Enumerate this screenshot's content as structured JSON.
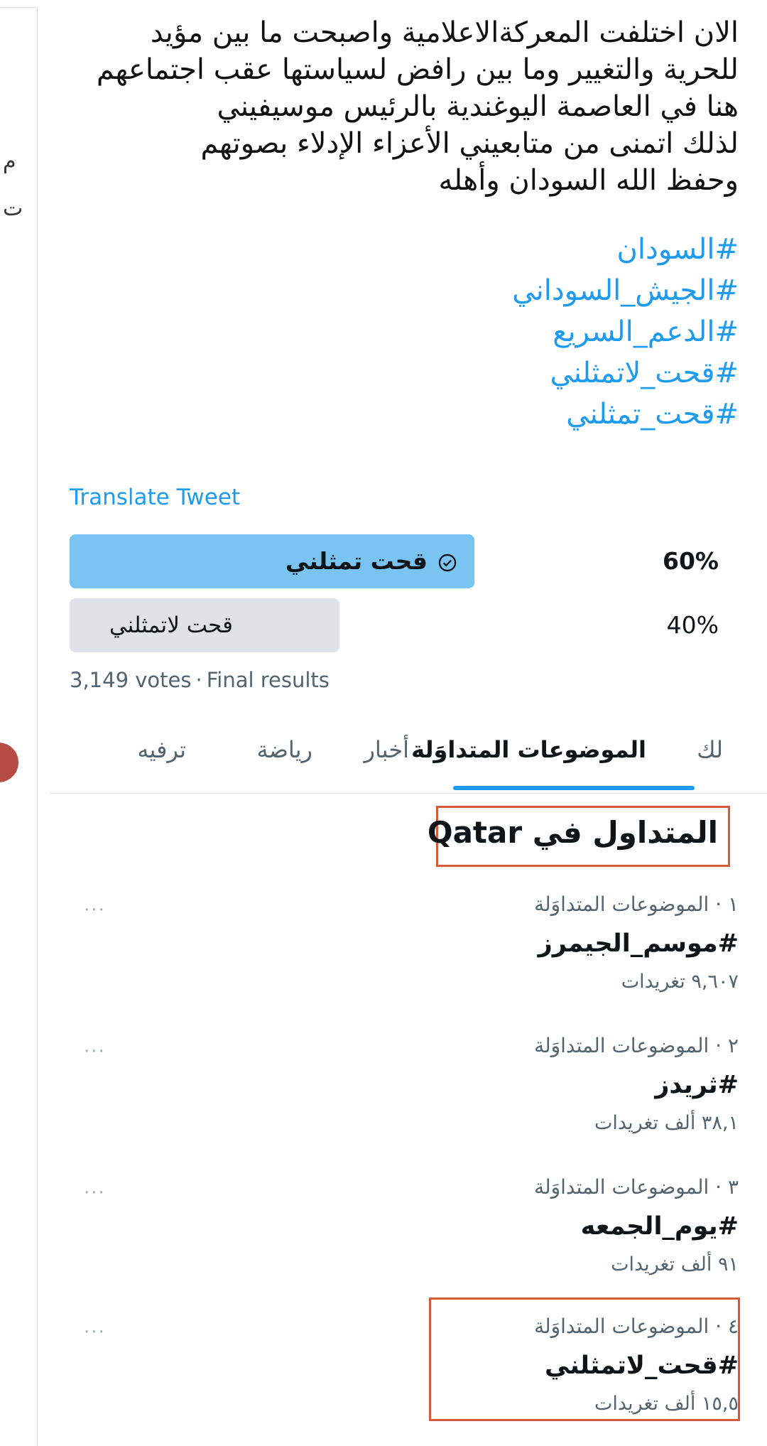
{
  "tweet": {
    "text_lines": [
      "الان اختلفت المعركةالاعلامية  واصبحت ما بين مؤيد",
      "للحرية والتغيير وما بين رافض لسياستها عقب اجتماعهم",
      "هنا في العاصمة اليوغندية بالرئيس موسيفيني",
      "لذلك اتمنى من متابعيني الأعزاء الإدلاء بصوتهم",
      "وحفظ الله السودان وأهله"
    ],
    "hashtags": [
      "#السودان",
      "#الجيش_السوداني",
      "#الدعم_السريع",
      "#قحت_لاتمثلني",
      "#قحت_تمثلني"
    ],
    "translate_label": "Translate Tweet"
  },
  "poll": {
    "options": [
      {
        "label": "قحت تمثلني",
        "percent_text": "60%",
        "share": 0.6,
        "winner": true
      },
      {
        "label": "قحت لاتمثلني",
        "percent_text": "40%",
        "share": 0.4,
        "winner": false
      }
    ],
    "votes_text": "3,149 votes",
    "separator": "·",
    "status_text": "Final results"
  },
  "tabs": {
    "items": [
      "لك",
      "الموضوعات المتداوَلة",
      "أخبار",
      "رياضة",
      "ترفيه"
    ],
    "active_index": 1
  },
  "region_heading": "المتداول في Qatar",
  "trends": [
    {
      "meta": "١ · الموضوعات المتداوَلة",
      "name": "#موسم_الجيمرز",
      "count": "٩,٦٠٧ تغريدات"
    },
    {
      "meta": "٢ · الموضوعات المتداوَلة",
      "name": "#ثريدز",
      "count": "٣٨,١ ألف تغريدات"
    },
    {
      "meta": "٣ · الموضوعات المتداوَلة",
      "name": "#يوم_الجمعه",
      "count": "٩١ ألف تغريدات"
    },
    {
      "meta": "٤ · الموضوعات المتداوَلة",
      "name": "#قحت_لاتمثلني",
      "count": "١٥,٥ ألف تغريدات"
    }
  ],
  "more_label": "···",
  "side_fragments": [
    "م",
    "ت"
  ],
  "colors": {
    "link": "#1d9bf0",
    "poll_winner": "#79c4f3",
    "poll_other": "#dfe2e6",
    "annotation": "#d65a3c"
  },
  "icons": {
    "poll_check": "check-circle-icon",
    "trend_more": "more-horizontal-icon"
  }
}
